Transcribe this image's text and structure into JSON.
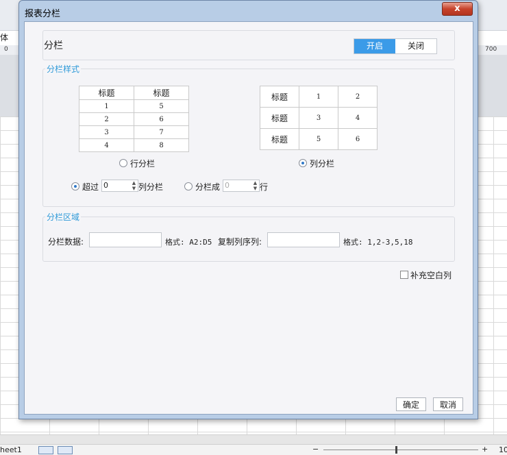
{
  "background": {
    "font_label": "体",
    "ruler_left": "0",
    "ruler_right": "700",
    "sheet_tab": "heet1",
    "zoom_minus": "−",
    "zoom_plus": "+",
    "zoom_value": "10"
  },
  "dialog": {
    "title": "报表分栏",
    "close_glyph": "x",
    "column_break": {
      "label": "分栏",
      "toggle_on": "开启",
      "toggle_off": "关闭",
      "state": "on"
    },
    "style_section": {
      "legend": "分栏样式",
      "row_preview": {
        "headers": [
          "标题",
          "标题"
        ],
        "rows": [
          [
            "1",
            "5"
          ],
          [
            "2",
            "6"
          ],
          [
            "3",
            "7"
          ],
          [
            "4",
            "8"
          ]
        ]
      },
      "col_preview": {
        "rows": [
          [
            "标题",
            "1",
            "2"
          ],
          [
            "标题",
            "3",
            "4"
          ],
          [
            "标题",
            "5",
            "6"
          ]
        ]
      },
      "row_option_label": "行分栏",
      "col_option_label": "列分栏",
      "selected_style": "col",
      "exceed_label": "超过",
      "exceed_value": "0",
      "exceed_suffix": "列分栏",
      "split_label": "分栏成",
      "split_value": "0",
      "split_suffix": "行",
      "selected_mode": "exceed"
    },
    "area_section": {
      "legend": "分栏区域",
      "data_label": "分栏数据:",
      "data_value": "",
      "data_format": "格式: A2:D5",
      "copy_label": "复制列序列:",
      "copy_value": "",
      "copy_format": "格式: 1,2-3,5,18"
    },
    "fill_blank_label": "补充空白列",
    "fill_blank_checked": false,
    "ok_label": "确定",
    "cancel_label": "取消"
  }
}
